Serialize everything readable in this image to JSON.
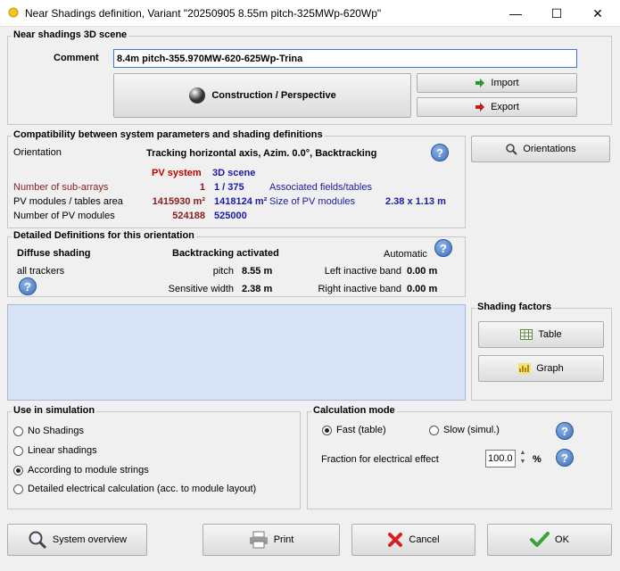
{
  "window": {
    "title": "Near Shadings definition, Variant \"20250905 8.55m pitch-325MWp-620Wp\"",
    "minimize": "—",
    "maximize": "☐",
    "close": "✕"
  },
  "scene": {
    "group_title": "Near shadings 3D scene",
    "comment_label": "Comment",
    "comment_value": "8.4m pitch-355.970MW-620-625Wp-Trina",
    "construction_label": "Construction / Perspective",
    "import_label": "Import",
    "export_label": "Export"
  },
  "compat": {
    "group_title": "Compatibility between system parameters and shading definitions",
    "orientation_label": "Orientation",
    "orientation_value": "Tracking horizontal axis, Azim. 0.0°, Backtracking",
    "col_pv_system": "PV system",
    "col_3d_scene": "3D scene",
    "rows": [
      {
        "label": "Number of sub-arrays",
        "pv": "1",
        "scene": "1 / 375"
      },
      {
        "label": "PV modules / tables area",
        "pv": "1415930 m²",
        "scene": "1418124 m²"
      },
      {
        "label": "Number of PV modules",
        "pv": "524188",
        "scene": "525000"
      }
    ],
    "associated_label": "Associated fields/tables",
    "size_label": "Size of PV modules",
    "size_value": "2.38 x 1.13 m"
  },
  "orientations_button": "Orientations",
  "detailed": {
    "group_title": "Detailed Definitions for this orientation",
    "diffuse_label": "Diffuse shading",
    "diffuse_value": "all trackers",
    "backtracking_label": "Backtracking activated",
    "automatic_label": "Automatic",
    "pitch_label": "pitch",
    "pitch_value": "8.55 m",
    "width_label": "Sensitive width",
    "width_value": "2.38 m",
    "left_band_label": "Left inactive band",
    "left_band_value": "0.00 m",
    "right_band_label": "Right inactive band",
    "right_band_value": "0.00 m"
  },
  "shading_factors": {
    "group_title": "Shading factors",
    "table_label": "Table",
    "graph_label": "Graph"
  },
  "simulation": {
    "group_title": "Use in simulation",
    "options": [
      "No Shadings",
      "Linear shadings",
      "According to module strings",
      "Detailed electrical calculation (acc. to module layout)"
    ],
    "selected": "According to module strings"
  },
  "calc_mode": {
    "group_title": "Calculation mode",
    "fast_label": "Fast (table)",
    "slow_label": "Slow (simul.)",
    "selected": "Fast (table)",
    "fraction_label": "Fraction for electrical effect",
    "fraction_value": "100.0",
    "fraction_unit": "%"
  },
  "footer": {
    "system_overview": "System overview",
    "print": "Print",
    "cancel": "Cancel",
    "ok": "OK"
  },
  "colors": {
    "pv_system_header": "#c00000",
    "scene_header": "#1a1aa6",
    "accent_red": "#8b1a1a",
    "link_blue": "#1a1aa6"
  }
}
